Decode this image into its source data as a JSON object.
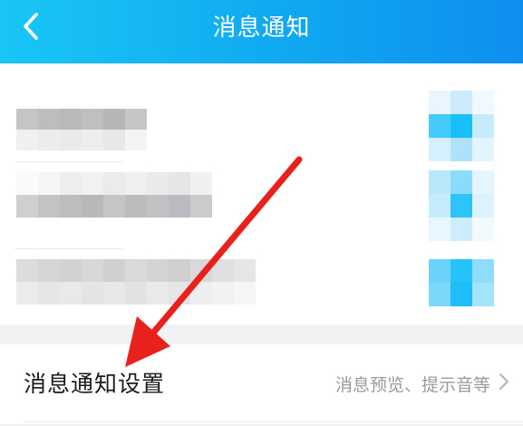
{
  "header": {
    "title": "消息通知",
    "back_icon": "chevron-left-icon",
    "gradient_colors": [
      "#19c6f6",
      "#0e8ff0"
    ]
  },
  "settings_row": {
    "label": "消息通知设置",
    "value": "消息预览、提示音等",
    "chevron_icon": "chevron-right-icon"
  },
  "annotation": {
    "arrow_color": "#e8211d",
    "arrow_icon": "red-arrow-icon"
  }
}
